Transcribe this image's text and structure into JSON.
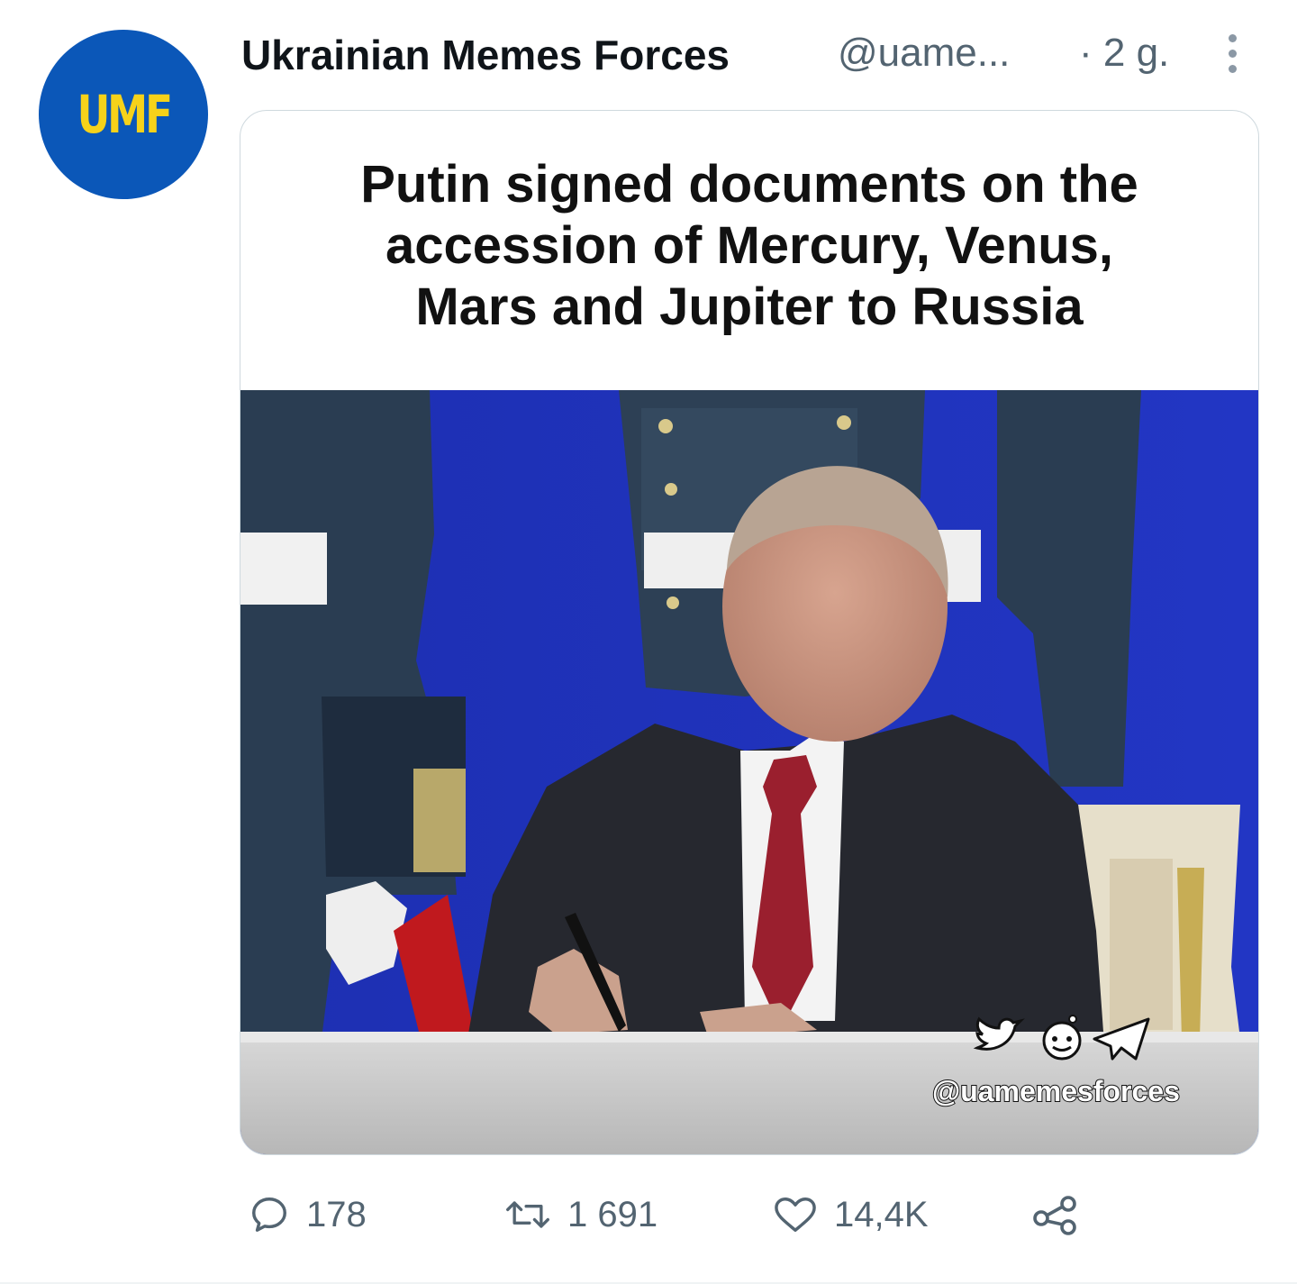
{
  "account": {
    "avatar_text": "UMF",
    "name": "Ukrainian Memes Forces",
    "handle": "@uame...",
    "time": "· 2 g."
  },
  "media": {
    "caption_lines": [
      "Putin signed documents on the",
      "accession of Mercury, Venus,",
      "Mars and Jupiter to Russia"
    ],
    "watermark_handle": "@uamemesforces",
    "watermark_icons": [
      "twitter-bird-icon",
      "reddit-icon",
      "telegram-icon"
    ]
  },
  "actions": {
    "replies": "178",
    "retweets": "1 691",
    "likes": "14,4K",
    "share_icon": "share-icon"
  },
  "colors": {
    "avatar_bg": "#0b57b8",
    "avatar_text": "#f6d21a",
    "muted_text": "#536471"
  }
}
